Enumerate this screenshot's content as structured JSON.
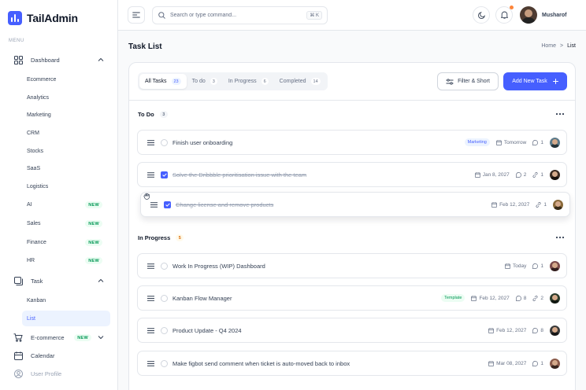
{
  "brand": {
    "name": "TailAdmin",
    "color": "#465fff"
  },
  "sidebar": {
    "menu_label": "MENU",
    "dashboard": {
      "label": "Dashboard",
      "icon": "grid-icon"
    },
    "dashboard_items": [
      {
        "label": "Ecommerce"
      },
      {
        "label": "Analytics"
      },
      {
        "label": "Marketing"
      },
      {
        "label": "CRM"
      },
      {
        "label": "Stocks"
      },
      {
        "label": "SaaS"
      },
      {
        "label": "Logistics"
      },
      {
        "label": "AI",
        "badge": "NEW"
      },
      {
        "label": "Sales",
        "badge": "NEW"
      },
      {
        "label": "Finance",
        "badge": "NEW"
      },
      {
        "label": "HR",
        "badge": "NEW"
      }
    ],
    "task": {
      "label": "Task",
      "icon": "task-icon"
    },
    "task_items": [
      {
        "label": "Kanban"
      },
      {
        "label": "List",
        "active": true
      }
    ],
    "ecommerce": {
      "label": "E-commerce",
      "badge": "NEW",
      "icon": "cart-icon"
    },
    "calendar": {
      "label": "Calendar",
      "icon": "calendar-icon"
    },
    "user_profile": {
      "label": "User Profile",
      "icon": "user-icon"
    }
  },
  "header": {
    "search_placeholder": "Search or type command...",
    "search_shortcut": "⌘ K",
    "user_name": "Musharof"
  },
  "page": {
    "title": "Task List",
    "breadcrumb": {
      "home": "Home",
      "separator": ">",
      "current": "List"
    }
  },
  "tabs": [
    {
      "label": "All Tasks",
      "count": "23",
      "active": true
    },
    {
      "label": "To do",
      "count": "3"
    },
    {
      "label": "In Progress",
      "count": "6"
    },
    {
      "label": "Completed",
      "count": "14"
    }
  ],
  "actions": {
    "filter_label": "Filter & Short",
    "add_label": "Add New Task"
  },
  "groups": {
    "todo": {
      "title": "To Do",
      "count": "3",
      "count_bg": "#f2f4f7",
      "count_color": "#667085"
    },
    "in_progress": {
      "title": "In Progress",
      "count": "5",
      "count_bg": "#fffaeb",
      "count_color": "#dc6803"
    }
  },
  "tasks": [
    {
      "title": "Finish user onboarding",
      "tag": "Marketing",
      "date": "Tomorrow",
      "comments": "1",
      "avatar_color": "#5b7a8a"
    },
    {
      "title": "Solve the Dribbble prioritisation issue with the team",
      "done": true,
      "date": "Jan 8, 2027",
      "comments": "2",
      "links": "1",
      "avatar_color": "#3a2a22"
    },
    {
      "title": "Change license and remove products",
      "done": true,
      "date": "Feb 12, 2027",
      "links": "1",
      "avatar_color": "#8a6a3a"
    },
    {
      "title": "Work In Progress (WIP) Dashboard",
      "date": "Today",
      "comments": "1",
      "avatar_color": "#7a4a4a"
    },
    {
      "title": "Kanban Flow Manager",
      "tag": "Template",
      "date": "Feb 12, 2027",
      "comments": "8",
      "links": "2",
      "avatar_color": "#2a3a2a"
    },
    {
      "title": "Product Update - Q4 2024",
      "date": "Feb 12, 2027",
      "comments": "8",
      "avatar_color": "#3a3a3a"
    },
    {
      "title": "Make figbot send comment when ticket is auto-moved back to inbox",
      "date": "Mar 08, 2027",
      "comments": "1",
      "avatar_color": "#8a5a4a"
    }
  ]
}
